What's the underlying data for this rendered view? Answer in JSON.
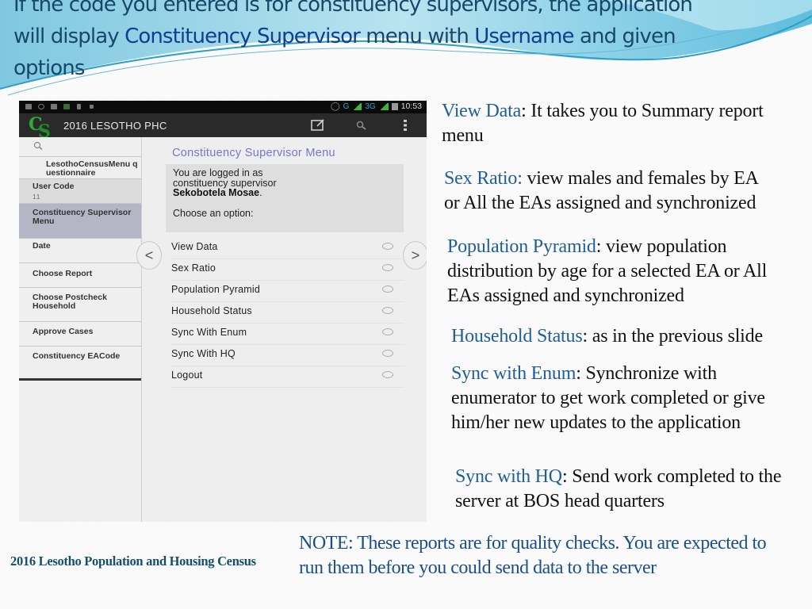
{
  "slide": {
    "title_parts": {
      "line1": "If the code you entered is for constituency supervisors, the application",
      "line2_pre": "will display ",
      "line2_highlight1": "Constituency Supervisor",
      "line2_mid": " menu with ",
      "line2_highlight2": "Username",
      "line2_post": " and given",
      "line3": "options"
    },
    "footer": "2016 Lesotho Population and Housing Census",
    "note": "NOTE: These reports are for quality checks. You are expected to run them before you could send data to the server"
  },
  "phone": {
    "status_bar": {
      "network": "G",
      "network2": "3G",
      "time": "10:53"
    },
    "action_bar": {
      "logo": "CS",
      "title": "2016 LESOTHO PHC",
      "icons": [
        "edit-icon",
        "search-icon",
        "overflow-menu-icon"
      ]
    },
    "drawer": {
      "items": [
        {
          "label": "LesothoCensusMenu questionnaire"
        },
        {
          "label": "User Code",
          "value": "11"
        },
        {
          "label": "Constituency Supervisor Menu",
          "active": true
        },
        {
          "label": "Date"
        },
        {
          "label": "Choose Report"
        },
        {
          "label": "Choose Postcheck Household"
        },
        {
          "label": "Approve Cases"
        },
        {
          "label": "Constituency EACode"
        }
      ]
    },
    "main": {
      "menu_title": "Constituency Supervisor Menu",
      "info": {
        "line1": "You are logged in as",
        "line2": "constituency supervisor",
        "username": "Sekobotela Mosae",
        "period": ".",
        "prompt": "Choose an option:"
      },
      "options": [
        {
          "label": "View Data",
          "selected": false
        },
        {
          "label": "Sex Ratio",
          "selected": false
        },
        {
          "label": "Population Pyramid",
          "selected": false
        },
        {
          "label": "Household Status",
          "selected": false
        },
        {
          "label": "Sync With Enum",
          "selected": false
        },
        {
          "label": "Sync With HQ",
          "selected": false
        },
        {
          "label": "Logout",
          "selected": false
        }
      ],
      "prev_arrow": "<",
      "next_arrow": ">"
    }
  },
  "explanations": [
    {
      "key": "View Data",
      "text": ": It takes you to Summary report menu"
    },
    {
      "key": "Sex Ratio:",
      "text": " view males and females by EA or All the EAs assigned and synchronized"
    },
    {
      "key": "Population Pyramid",
      "text": ": view population distribution by age for a selected EA or All EAs assigned and synchronized"
    },
    {
      "key": "Household Status",
      "text": ": as in the previous slide"
    },
    {
      "key": "Sync with Enum",
      "text": ": Synchronize with enumerator to get work completed or give him/her new updates to the application"
    },
    {
      "key": "Sync with HQ",
      "text": ": Send work completed to the server at BOS head quarters"
    }
  ],
  "colors": {
    "title": "#17486a",
    "key_highlight": "#1f5e9a",
    "menu_title": "#7577cf",
    "active_drawer": "#b4b6c6",
    "note": "#1a4f8a"
  }
}
